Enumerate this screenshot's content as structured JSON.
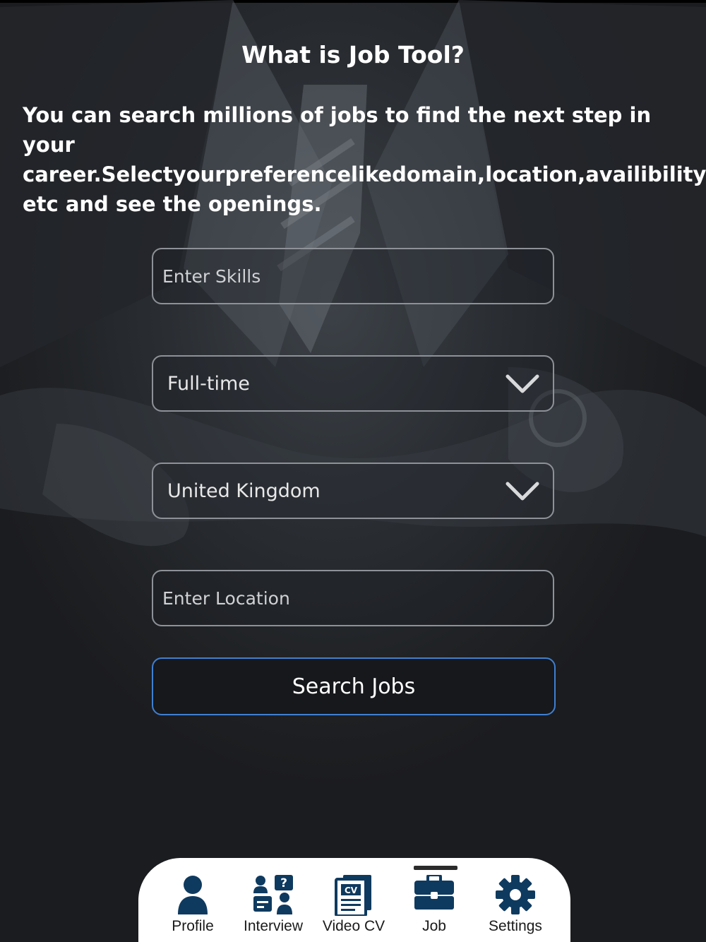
{
  "header": {
    "title": "What is Job Tool?",
    "description": "You can search millions of jobs to find the next step in your career.Selectyourpreferencelikedomain,location,availibility etc and see the openings."
  },
  "form": {
    "skills_placeholder": "Enter Skills",
    "job_type_value": "Full-time",
    "country_value": "United Kingdom",
    "location_placeholder": "Enter Location",
    "search_label": "Search Jobs"
  },
  "nav": {
    "items": [
      {
        "label": "Profile",
        "icon": "person-icon"
      },
      {
        "label": "Interview",
        "icon": "interview-icon"
      },
      {
        "label": "Video CV",
        "icon": "cv-document-icon"
      },
      {
        "label": "Job",
        "icon": "briefcase-icon",
        "active": true
      },
      {
        "label": "Settings",
        "icon": "gear-icon"
      }
    ]
  },
  "colors": {
    "icon_navy": "#0f3a5f",
    "button_border": "#3f7fd1",
    "background": "#1c1d20"
  }
}
